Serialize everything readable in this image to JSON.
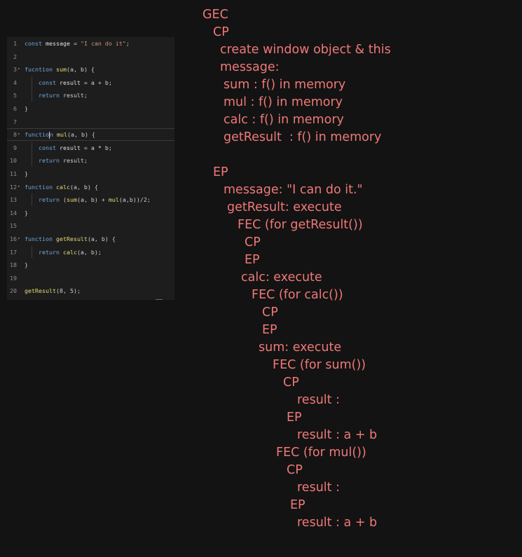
{
  "colors": {
    "background": "#131313",
    "editor_background": "#1d1d1d",
    "note_text": "#f07878",
    "keyword": "#6fa8dc",
    "function_name": "#e6db74",
    "string": "#ce9178",
    "line_number": "#8f8f8f"
  },
  "code_editor": {
    "lines": [
      {
        "num": "1",
        "fold": false,
        "tokens": [
          {
            "t": "const ",
            "c": "kw"
          },
          {
            "t": "message",
            "c": "id"
          },
          {
            "t": " = ",
            "c": "p"
          },
          {
            "t": "\"I can do it\"",
            "c": "str"
          },
          {
            "t": ";",
            "c": "p"
          }
        ]
      },
      {
        "num": "2",
        "fold": false,
        "tokens": []
      },
      {
        "num": "3",
        "fold": true,
        "tokens": [
          {
            "t": "fucntion ",
            "c": "kw"
          },
          {
            "t": "sum",
            "c": "fn"
          },
          {
            "t": "(a, b) {",
            "c": "p"
          }
        ]
      },
      {
        "num": "4",
        "fold": false,
        "guide": true,
        "tokens": [
          {
            "t": "    const ",
            "c": "kw"
          },
          {
            "t": "result",
            "c": "id"
          },
          {
            "t": " = a + b;",
            "c": "p"
          }
        ]
      },
      {
        "num": "5",
        "fold": false,
        "guide": true,
        "tokens": [
          {
            "t": "    return ",
            "c": "kw"
          },
          {
            "t": "result;",
            "c": "p"
          }
        ]
      },
      {
        "num": "6",
        "fold": false,
        "tokens": [
          {
            "t": "}",
            "c": "p"
          }
        ]
      },
      {
        "num": "7",
        "fold": false,
        "tokens": []
      },
      {
        "num": "8",
        "fold": true,
        "active": true,
        "tokens": [
          {
            "t": "functio",
            "c": "kw"
          },
          {
            "t": "CARET",
            "c": "caret"
          },
          {
            "t": "n ",
            "c": "kw"
          },
          {
            "t": "mul",
            "c": "fn"
          },
          {
            "t": "(a, b) {",
            "c": "p"
          }
        ]
      },
      {
        "num": "9",
        "fold": false,
        "guide": true,
        "tokens": [
          {
            "t": "    const ",
            "c": "kw"
          },
          {
            "t": "result",
            "c": "id"
          },
          {
            "t": " = a * b;",
            "c": "p"
          }
        ]
      },
      {
        "num": "10",
        "fold": false,
        "guide": true,
        "tokens": [
          {
            "t": "    return ",
            "c": "kw"
          },
          {
            "t": "result;",
            "c": "p"
          }
        ]
      },
      {
        "num": "11",
        "fold": false,
        "tokens": [
          {
            "t": "}",
            "c": "p"
          }
        ]
      },
      {
        "num": "12",
        "fold": true,
        "tokens": [
          {
            "t": "function ",
            "c": "kw"
          },
          {
            "t": "calc",
            "c": "fn"
          },
          {
            "t": "(a, b) {",
            "c": "p"
          }
        ]
      },
      {
        "num": "13",
        "fold": false,
        "guide": true,
        "tokens": [
          {
            "t": "    return ",
            "c": "kw"
          },
          {
            "t": "(",
            "c": "p"
          },
          {
            "t": "sum",
            "c": "fn"
          },
          {
            "t": "(a, b) + ",
            "c": "p"
          },
          {
            "t": "mul",
            "c": "fn"
          },
          {
            "t": "(a,b))/2;",
            "c": "p"
          }
        ]
      },
      {
        "num": "14",
        "fold": false,
        "tokens": [
          {
            "t": "}",
            "c": "p"
          }
        ]
      },
      {
        "num": "15",
        "fold": false,
        "tokens": []
      },
      {
        "num": "16",
        "fold": true,
        "tokens": [
          {
            "t": "function ",
            "c": "kw"
          },
          {
            "t": "getResult",
            "c": "fn"
          },
          {
            "t": "(a, b) {",
            "c": "p"
          }
        ]
      },
      {
        "num": "17",
        "fold": false,
        "guide": true,
        "tokens": [
          {
            "t": "    return ",
            "c": "kw"
          },
          {
            "t": "calc",
            "c": "fn"
          },
          {
            "t": "(a, b);",
            "c": "p"
          }
        ]
      },
      {
        "num": "18",
        "fold": false,
        "tokens": [
          {
            "t": "}",
            "c": "p"
          }
        ]
      },
      {
        "num": "19",
        "fold": false,
        "tokens": []
      },
      {
        "num": "20",
        "fold": false,
        "tokens": [
          {
            "t": "getResult",
            "c": "fn"
          },
          {
            "t": "(8, 5);",
            "c": "p"
          }
        ]
      }
    ]
  },
  "notes": {
    "lines": [
      {
        "text": "GEC",
        "level": 0
      },
      {
        "text": "CP",
        "level": 1
      },
      {
        "text": "create window object & this",
        "level": 2
      },
      {
        "text": "message:",
        "level": 2
      },
      {
        "text": "sum : f() in memory",
        "level": 3
      },
      {
        "text": "mul : f() in memory",
        "level": 3
      },
      {
        "text": "calc : f() in memory",
        "level": 3
      },
      {
        "text": "getResult  : f() in memory",
        "level": 3
      },
      {
        "text": "",
        "level": 0
      },
      {
        "text": "EP",
        "level": 1
      },
      {
        "text": "message: \"I can do it.\"",
        "level": 4
      },
      {
        "text": "getResult: execute",
        "level": 5
      },
      {
        "text": "FEC (for getResult())",
        "level": 6
      },
      {
        "text": "CP",
        "level": 7
      },
      {
        "text": "EP",
        "level": 7
      },
      {
        "text": "calc: execute",
        "level": 8
      },
      {
        "text": "FEC (for calc())",
        "level": 9
      },
      {
        "text": "CP",
        "level": 10
      },
      {
        "text": "EP",
        "level": 10
      },
      {
        "text": "sum: execute",
        "level": 11
      },
      {
        "text": "FEC (for sum())",
        "level": 12
      },
      {
        "text": "CP",
        "level": 13
      },
      {
        "text": "result :",
        "level": 14
      },
      {
        "text": "EP",
        "level": 15
      },
      {
        "text": "result : a + b",
        "level": 14
      },
      {
        "text": "FEC (for mul())",
        "level": 16
      },
      {
        "text": "CP",
        "level": 15
      },
      {
        "text": "result :",
        "level": 14
      },
      {
        "text": "EP",
        "level": 17
      },
      {
        "text": "result : a + b",
        "level": 14
      }
    ]
  }
}
